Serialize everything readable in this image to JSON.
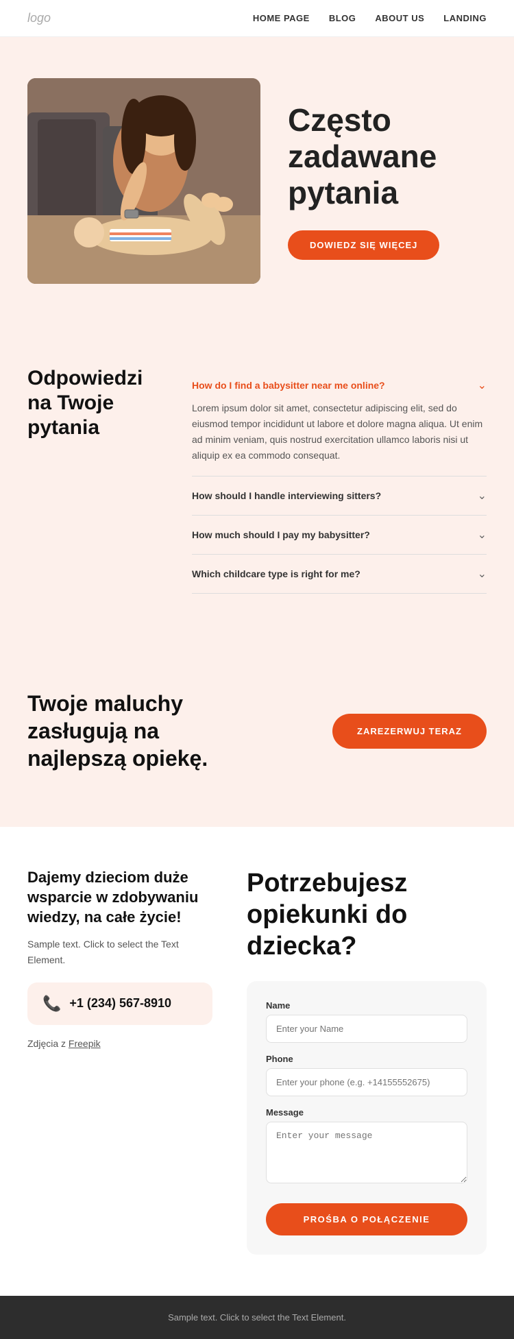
{
  "nav": {
    "logo": "logo",
    "links": [
      {
        "id": "home",
        "label": "HOME PAGE"
      },
      {
        "id": "blog",
        "label": "BLOG"
      },
      {
        "id": "about",
        "label": "ABOUT US"
      },
      {
        "id": "landing",
        "label": "LANDING"
      }
    ]
  },
  "hero": {
    "title": "Często zadawane pytania",
    "button": "DOWIEDZ SIĘ WIĘCEJ"
  },
  "faq": {
    "heading": "Odpowiedzi na Twoje pytania",
    "items": [
      {
        "id": "q1",
        "question": "How do I find a babysitter near me online?",
        "answer": "Lorem ipsum dolor sit amet, consectetur adipiscing elit, sed do eiusmod tempor incididunt ut labore et dolore magna aliqua. Ut enim ad minim veniam, quis nostrud exercitation ullamco laboris nisi ut aliquip ex ea commodo consequat.",
        "open": true,
        "orange": true
      },
      {
        "id": "q2",
        "question": "How should I handle interviewing sitters?",
        "answer": "",
        "open": false,
        "orange": false
      },
      {
        "id": "q3",
        "question": "How much should I pay my babysitter?",
        "answer": "",
        "open": false,
        "orange": false
      },
      {
        "id": "q4",
        "question": "Which childcare type is right for me?",
        "answer": "",
        "open": false,
        "orange": false
      }
    ]
  },
  "cta": {
    "heading": "Twoje maluchy zasługują na najlepszą opiekę.",
    "button": "ZAREZERWUJ TERAZ"
  },
  "contact": {
    "left": {
      "heading": "Dajemy dzieciom duże wsparcie w zdobywaniu wiedzy, na całe życie!",
      "text": "Sample text. Click to select the Text Element.",
      "phone": "+1 (234) 567-8910",
      "photo_credit_prefix": "Zdjęcia z ",
      "photo_credit_link": "Freepik"
    },
    "right": {
      "heading": "Potrzebujesz opiekunki do dziecka?"
    },
    "form": {
      "name_label": "Name",
      "name_placeholder": "Enter your Name",
      "phone_label": "Phone",
      "phone_placeholder": "Enter your phone (e.g. +14155552675)",
      "message_label": "Message",
      "message_placeholder": "Enter your message",
      "submit_label": "PROŚBA O POŁĄCZENIE"
    }
  },
  "footer": {
    "text": "Sample text. Click to select the Text Element."
  }
}
